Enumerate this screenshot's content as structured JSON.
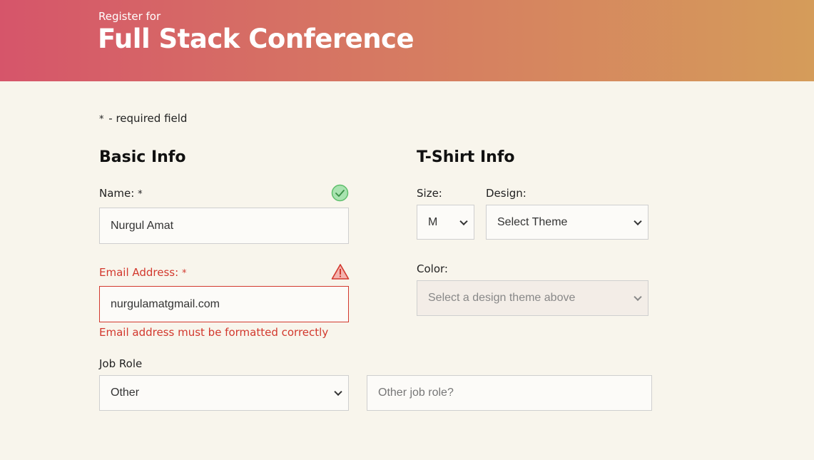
{
  "header": {
    "pretitle": "Register for",
    "title": "Full Stack Conference"
  },
  "required_note": {
    "star": "*",
    "text": "- required field"
  },
  "basic_info": {
    "title": "Basic Info",
    "name": {
      "label": "Name:",
      "star": "*",
      "value": "Nurgul Amat",
      "status": "valid"
    },
    "email": {
      "label": "Email Address:",
      "star": "*",
      "value": "nurgulamatgmail.com",
      "status": "error",
      "error_message": "Email address must be formatted correctly"
    },
    "job_role": {
      "label": "Job Role",
      "selected": "Other",
      "other_placeholder": "Other job role?"
    }
  },
  "tshirt_info": {
    "title": "T-Shirt Info",
    "size": {
      "label": "Size:",
      "selected": "M"
    },
    "design": {
      "label": "Design:",
      "selected": "Select Theme"
    },
    "color": {
      "label": "Color:",
      "selected": "Select a design theme above",
      "disabled": true
    }
  },
  "colors": {
    "accent_error": "#d2382d",
    "valid_green": "#7ed08a",
    "header_gradient_start": "#d6556a",
    "header_gradient_end": "#d59c5a",
    "background": "#f8f5ec"
  }
}
